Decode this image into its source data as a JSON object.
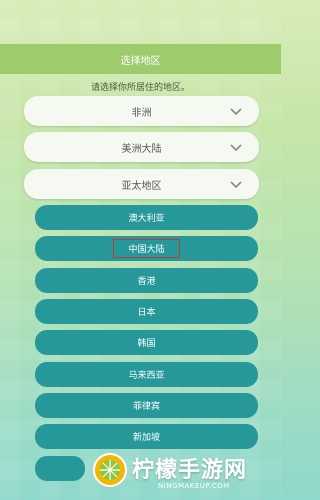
{
  "header": {
    "title": "选择地区"
  },
  "prompt": "请选择你所居住的地区。",
  "regions": [
    {
      "label": "非洲"
    },
    {
      "label": "美洲大陆"
    },
    {
      "label": "亚太地区"
    }
  ],
  "countries": [
    {
      "label": "澳大利亚"
    },
    {
      "label": "中国大陆"
    },
    {
      "label": "香港"
    },
    {
      "label": "日本"
    },
    {
      "label": "韩国"
    },
    {
      "label": "马来西亚"
    },
    {
      "label": "菲律宾"
    },
    {
      "label": "新加坡"
    }
  ],
  "watermark": {
    "name": "柠檬手游网",
    "url": "NINGMAKEUP.COM"
  },
  "colors": {
    "accent": "#27989a",
    "header": "#9ecb6c",
    "selection_outline": "#c0392b"
  }
}
